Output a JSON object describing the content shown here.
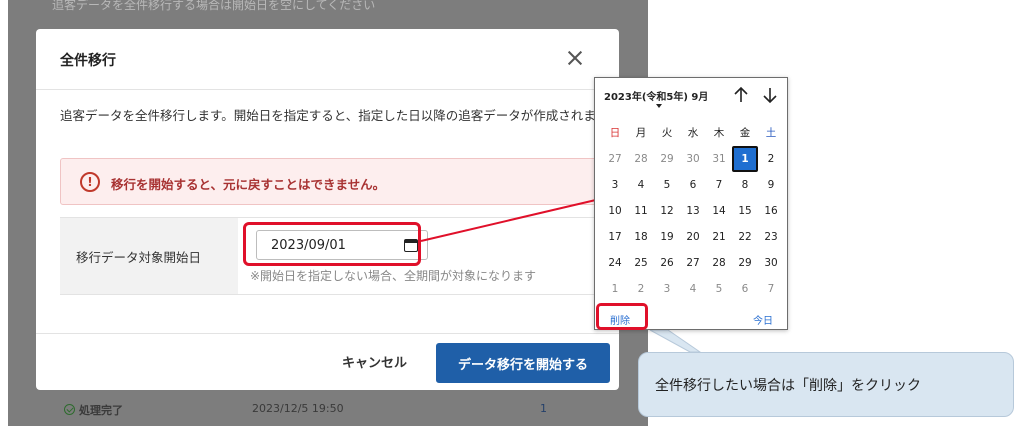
{
  "background": {
    "top_text": "追客データを全件移行する場合は開始日を空にしてください",
    "row": {
      "status": "処理完了",
      "date": "2023/12/5 19:50",
      "count": "1"
    }
  },
  "modal": {
    "title": "全件移行",
    "description": "追客データを全件移行します。開始日を指定すると、指定した日以降の追客データが作成されます。",
    "alert": {
      "icon": "!",
      "text": "移行を開始すると、元に戻すことはできません。"
    },
    "form": {
      "label": "移行データ対象開始日",
      "date_value": "2023/09/01",
      "hint": "※開始日を指定しない場合、全期間が対象になります"
    },
    "footer": {
      "cancel_label": "キャンセル",
      "start_label": "データ移行を開始する"
    }
  },
  "calendar": {
    "month_label": "2023年(令和5年) 9月",
    "weekdays": [
      "日",
      "月",
      "火",
      "水",
      "木",
      "金",
      "土"
    ],
    "weeks": [
      [
        "27",
        "28",
        "29",
        "30",
        "31",
        "1",
        "2"
      ],
      [
        "3",
        "4",
        "5",
        "6",
        "7",
        "8",
        "9"
      ],
      [
        "10",
        "11",
        "12",
        "13",
        "14",
        "15",
        "16"
      ],
      [
        "17",
        "18",
        "19",
        "20",
        "21",
        "22",
        "23"
      ],
      [
        "24",
        "25",
        "26",
        "27",
        "28",
        "29",
        "30"
      ],
      [
        "1",
        "2",
        "3",
        "4",
        "5",
        "6",
        "7"
      ]
    ],
    "selected_day": "1",
    "delete_label": "削除",
    "today_label": "今日"
  },
  "callout": {
    "text": "全件移行したい場合は「削除」をクリック"
  },
  "colors": {
    "accent": "#1f5fa8",
    "highlight": "#e0102a",
    "alert_bg": "#fdeeee",
    "callout_bg": "#d9e6f1"
  }
}
